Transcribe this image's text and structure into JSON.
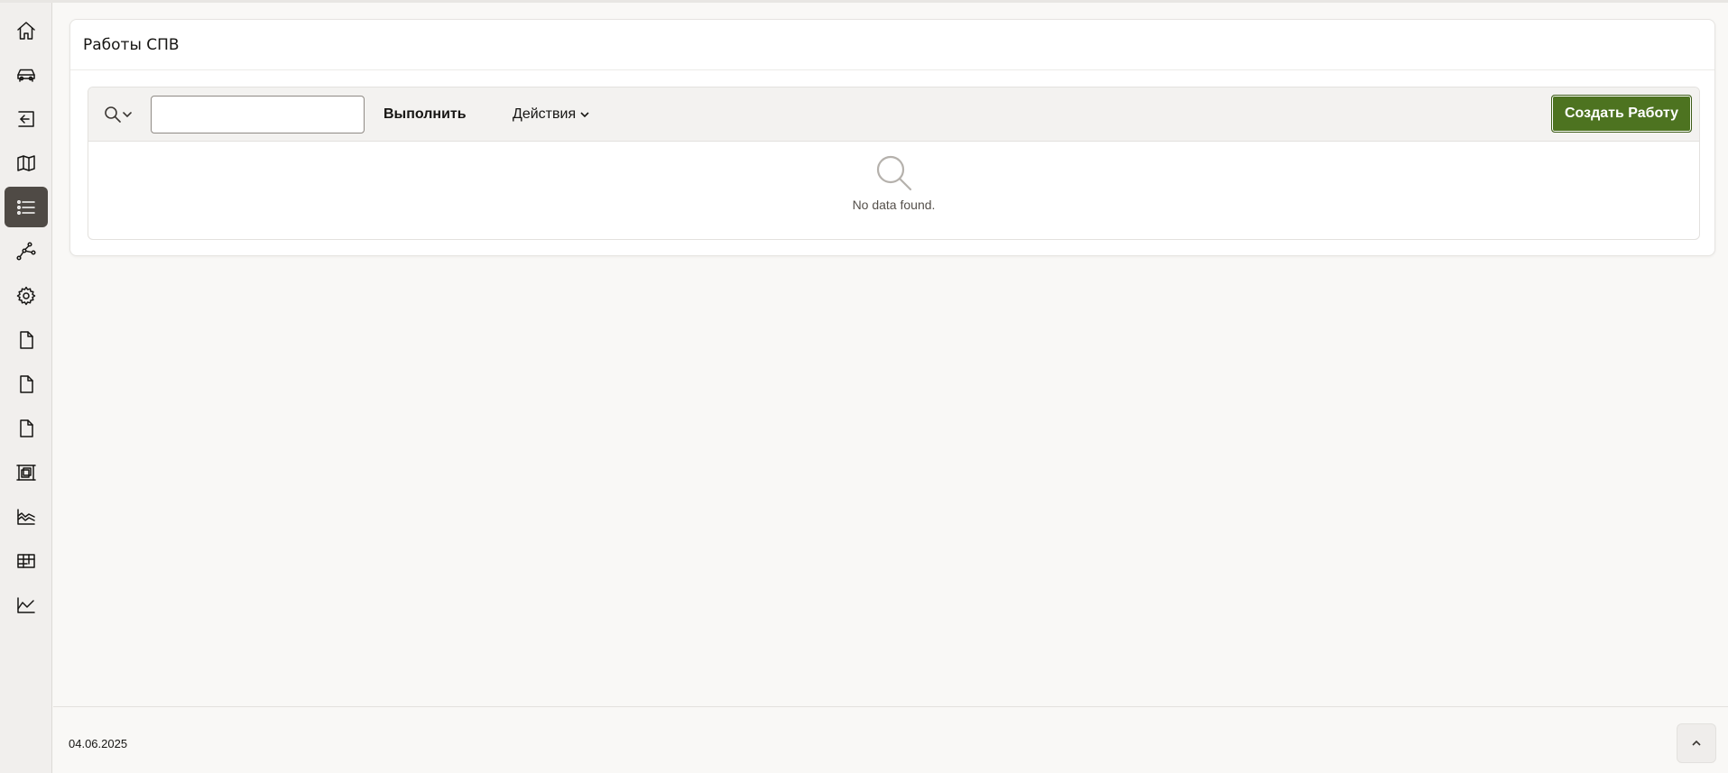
{
  "region": {
    "title": "Работы СПВ"
  },
  "toolbar": {
    "search_value": "",
    "go_label": "Выполнить",
    "actions_label": "Действия",
    "create_label": "Создать Работу"
  },
  "report": {
    "no_data_text": "No data found."
  },
  "footer": {
    "date": "04.06.2025"
  },
  "sidebar": {
    "items": [
      {
        "icon": "home-icon"
      },
      {
        "icon": "car-icon"
      },
      {
        "icon": "sign-in-icon"
      },
      {
        "icon": "map-icon"
      },
      {
        "icon": "list-icon",
        "active": true
      },
      {
        "icon": "route-icon"
      },
      {
        "icon": "gear-icon"
      },
      {
        "icon": "file-icon"
      },
      {
        "icon": "file-icon"
      },
      {
        "icon": "file-icon"
      },
      {
        "icon": "frame-icon"
      },
      {
        "icon": "area-chart-icon"
      },
      {
        "icon": "table-icon"
      },
      {
        "icon": "line-chart-icon"
      }
    ]
  },
  "colors": {
    "accent": "#4d7320",
    "active_nav": "#4f4a45",
    "background": "#f9f8f6"
  }
}
